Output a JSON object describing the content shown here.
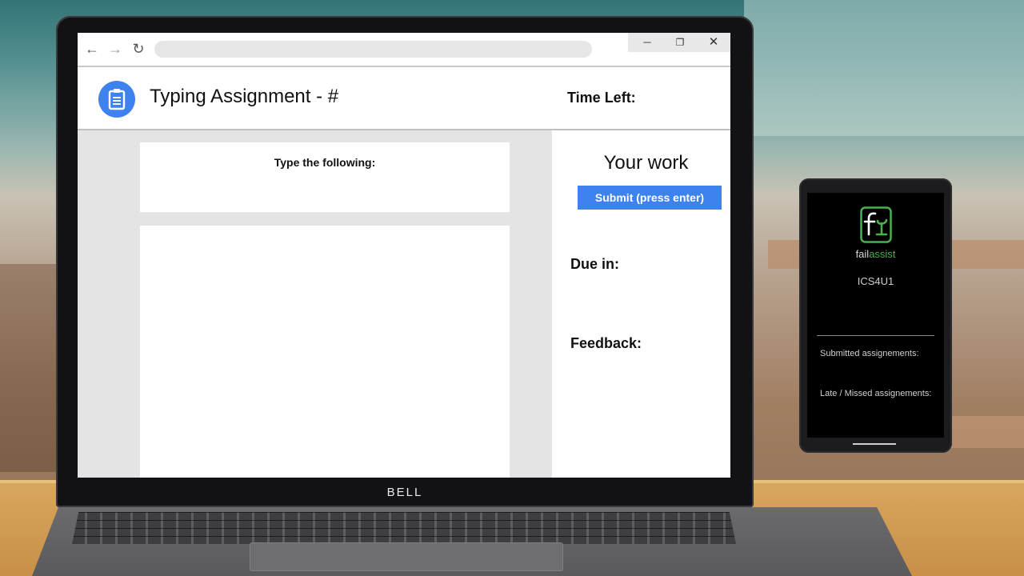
{
  "browser": {
    "address_value": ""
  },
  "window_controls": {
    "minimize": "─",
    "maximize": "❐",
    "close": "✕"
  },
  "laptop": {
    "brand": "BELL"
  },
  "app": {
    "title": "Typing Assignment - #",
    "time_left_label": "Time Left:",
    "icon": "clipboard-icon"
  },
  "prompt": {
    "label": "Type the following:"
  },
  "typing": {
    "value": ""
  },
  "sidebar": {
    "heading": "Your work",
    "submit_label": "Submit (press enter)",
    "due_label": "Due in:",
    "feedback_label": "Feedback:"
  },
  "phone": {
    "brand_part1": "fail",
    "brand_part2": "assist",
    "course": "ICS4U1",
    "submitted_label": "Submitted assignements:",
    "late_label": "Late / Missed assignements:"
  },
  "colors": {
    "accent_blue": "#3e82f0",
    "brand_green": "#4caf50",
    "pane_gray": "#e4e4e4"
  }
}
